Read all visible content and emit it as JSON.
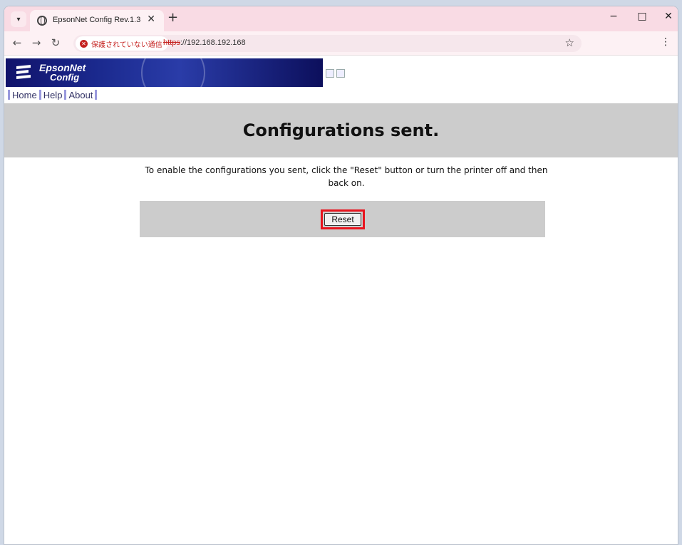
{
  "browser": {
    "tab_title": "EpsonNet Config Rev.1.3",
    "security_label": "保護されていない通信",
    "url_scheme": "https",
    "url_rest": "://192.168.192.168",
    "new_tab_symbol": "+",
    "tab_close_symbol": "✕",
    "minimize_symbol": "−",
    "maximize_symbol": "□",
    "close_symbol": "✕"
  },
  "banner": {
    "logo_line1": "EpsonNet",
    "logo_line2": "Config"
  },
  "nav": {
    "links": [
      "Home",
      "Help",
      "About"
    ]
  },
  "page": {
    "heading": "Configurations sent.",
    "message": "To enable the configurations you sent, click the \"Reset\" button or turn the printer off and then back on.",
    "reset_label": "Reset"
  },
  "colors": {
    "highlight": "#e8141e",
    "band_gray": "#cccccc",
    "tab_bar": "#f9dbe4"
  }
}
